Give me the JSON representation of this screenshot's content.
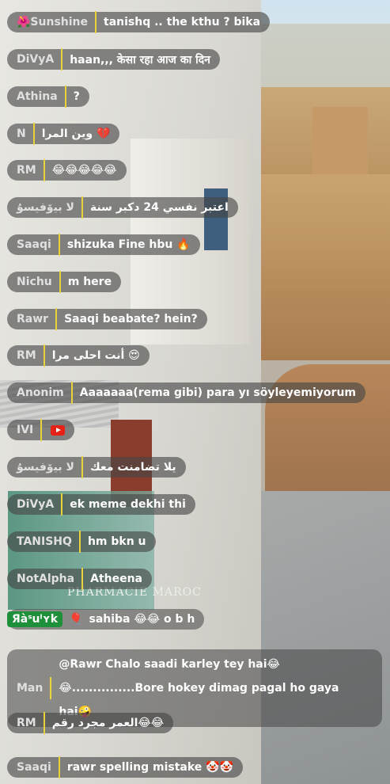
{
  "messages": [
    {
      "name": "🌺Sunshine",
      "text": "tanishq .. the kthu ? bika"
    },
    {
      "name": "DiVyA",
      "text": "haan,,, केसा रहा आज का दिन"
    },
    {
      "name": "Athina",
      "text": "?"
    },
    {
      "name": "N",
      "text": "وين المرا 💔"
    },
    {
      "name": "RM",
      "text": "😂😂😂😂😂"
    },
    {
      "name": "ﻻ ﺑﻴﯙﻓﻴﺴﯘ",
      "text": "اعتبر نفسي 24 دكبر سنة"
    },
    {
      "name": "Saaqi",
      "text": "shizuka Fine hbu 🔥"
    },
    {
      "name": "Nichu",
      "text": "m here"
    },
    {
      "name": "Rawr",
      "text": "Saaqi beabate? hein?"
    },
    {
      "name": "RM",
      "text": "أنت احلى مرا 😍"
    },
    {
      "name": "Anonim",
      "text": "Aaaaaaa(rema gibi) para yı söyleyemiyorum"
    },
    {
      "name": "ΙVΙ",
      "text": ""
    },
    {
      "name": "ﻻ ﺑﻴﯙﻓﻴﺴﯘ",
      "text": "يلا تضامنت معك"
    },
    {
      "name": "DiVyA",
      "text": "ek meme dekhi thi"
    },
    {
      "name": "TANISHQ",
      "text": "hm bkn u"
    },
    {
      "name": "NotAlpha",
      "text": "Atheena"
    },
    {
      "name": "Яàˢuˡʏk",
      "text": "sahiba 😂😂 o b h"
    },
    {
      "name": "Man",
      "text": "@Rawr Chalo saadi karley tey hai😂😂...............Bore hokey dimag pagal ho gaya hai🤪"
    },
    {
      "name": "RM",
      "text": "العمر مجرد رقم😂😂"
    },
    {
      "name": "Saaqi",
      "text": "rawr spelling mistake 🤡🤡"
    }
  ],
  "background": {
    "sign_text": "PHARMACIE MAROC"
  },
  "colors": {
    "separator": "#e8d33b",
    "bubble": "rgba(70,70,70,0.62)",
    "highlight_name": "#1e8f3a"
  },
  "icons": {
    "youtube": "youtube-icon",
    "badge": "badge-icon"
  }
}
